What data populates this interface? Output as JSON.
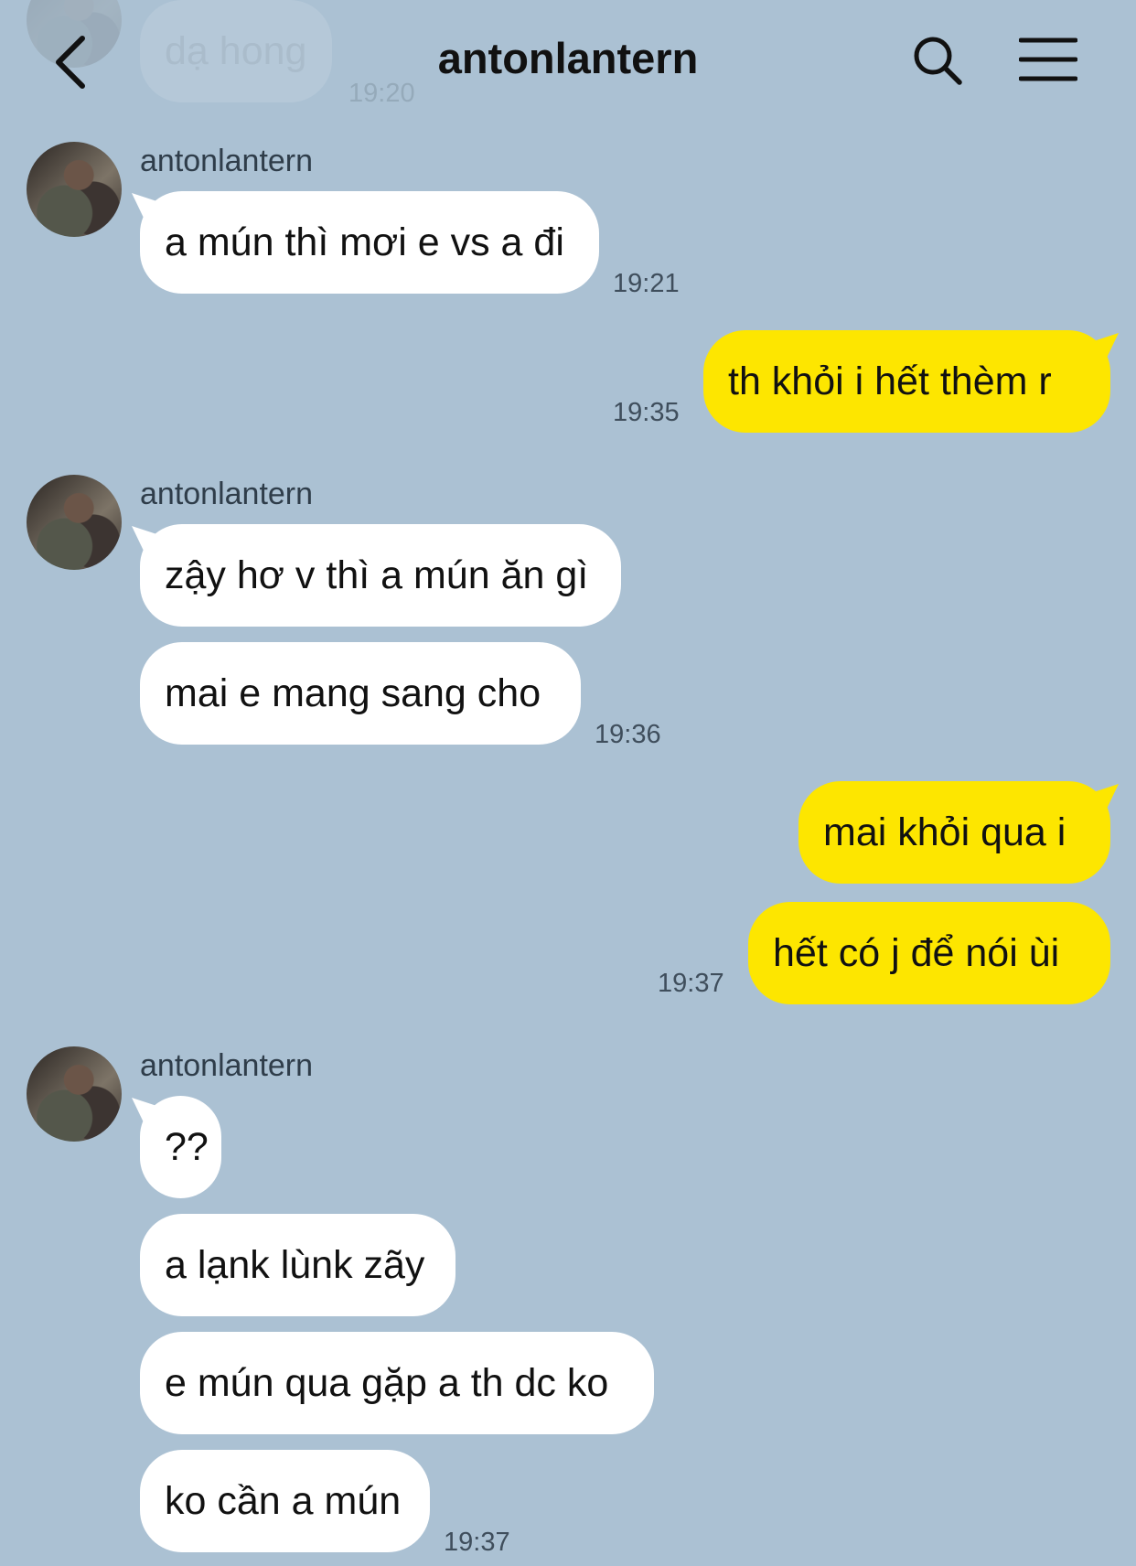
{
  "header": {
    "title": "antonlantern",
    "back_icon": "chevron-left-icon",
    "search_icon": "search-icon",
    "menu_icon": "hamburger-menu-icon"
  },
  "colors": {
    "background": "#abc1d3",
    "incoming_bubble": "#ffffff",
    "outgoing_bubble": "#fde600"
  },
  "messages": [
    {
      "direction": "in",
      "text": "dạ hong",
      "time": "19:20",
      "faded": true
    },
    {
      "direction": "in",
      "sender": "antonlantern",
      "text": "a mún thì mơi e vs a đi",
      "time": "19:21"
    },
    {
      "direction": "out",
      "text": "th khỏi i hết thèm r",
      "time": "19:35"
    },
    {
      "direction": "in",
      "sender": "antonlantern",
      "text": "zậy hơ v thì a mún ăn gì"
    },
    {
      "direction": "in",
      "text": "mai e mang sang cho",
      "time": "19:36"
    },
    {
      "direction": "out",
      "text": "mai khỏi qua i"
    },
    {
      "direction": "out",
      "text": "hết có j để nói ùi",
      "time": "19:37"
    },
    {
      "direction": "in",
      "sender": "antonlantern",
      "text": "??"
    },
    {
      "direction": "in",
      "text": "a lạnk lùnk zãy"
    },
    {
      "direction": "in",
      "text": "e mún qua gặp a th dc ko"
    },
    {
      "direction": "in",
      "text": "ko cần a mún",
      "time": "19:37"
    }
  ]
}
